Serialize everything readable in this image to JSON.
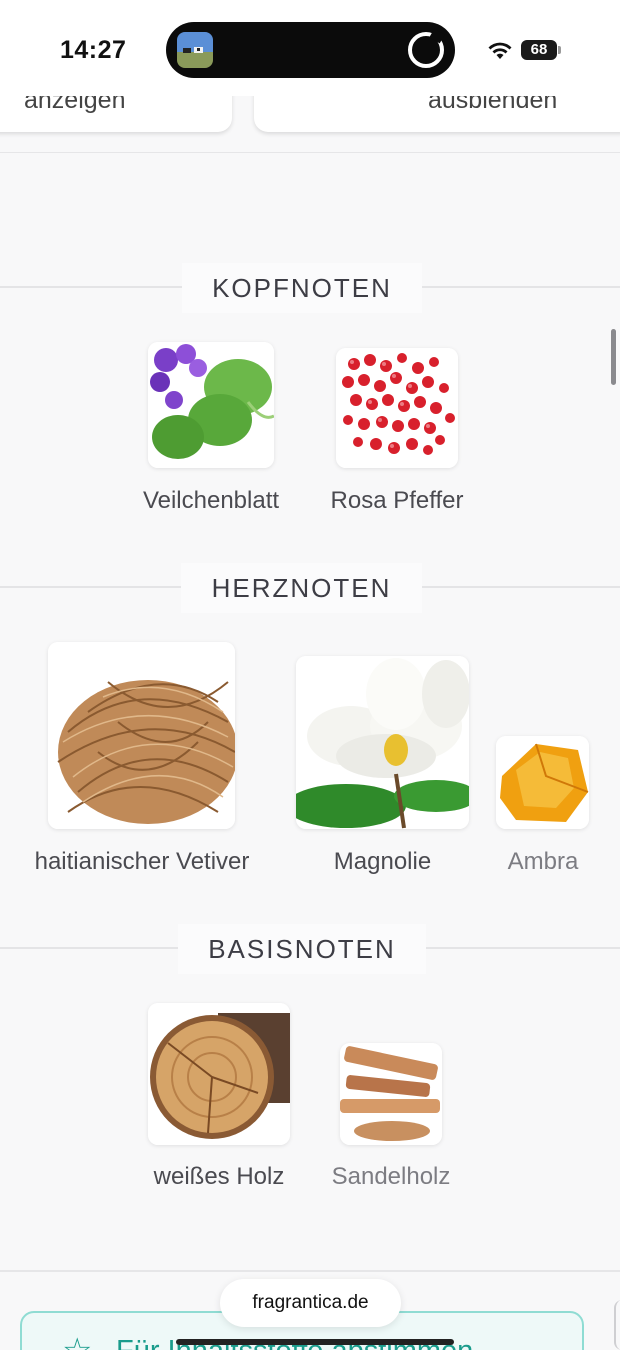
{
  "status_bar": {
    "time": "14:27",
    "battery": "68",
    "icons": [
      "now-playing-thumbnail-icon",
      "recording-ring-icon",
      "wifi-icon",
      "battery-icon"
    ]
  },
  "toggles": {
    "left_label": "anzeigen",
    "right_label": "ausblenden"
  },
  "sections": {
    "top": {
      "title": "KOPFNOTEN",
      "notes": [
        {
          "label": "Veilchenblatt",
          "icon": "violet-leaf-image"
        },
        {
          "label": "Rosa Pfeffer",
          "icon": "pink-pepper-image"
        }
      ]
    },
    "heart": {
      "title": "HERZNOTEN",
      "notes": [
        {
          "label": "haitianischer Vetiver",
          "icon": "vetiver-root-image"
        },
        {
          "label": "Magnolie",
          "icon": "magnolia-image"
        },
        {
          "label": "Ambra",
          "icon": "amber-image"
        }
      ]
    },
    "base": {
      "title": "BASISNOTEN",
      "notes": [
        {
          "label": "weißes Holz",
          "icon": "white-wood-image"
        },
        {
          "label": "Sandelholz",
          "icon": "sandalwood-image"
        }
      ]
    }
  },
  "domain": "fragrantica.de",
  "vote_banner": {
    "text": "Für Inhaltsstoffe abstimmen",
    "icon": "star-icon",
    "accent": "#1a9c8c"
  }
}
